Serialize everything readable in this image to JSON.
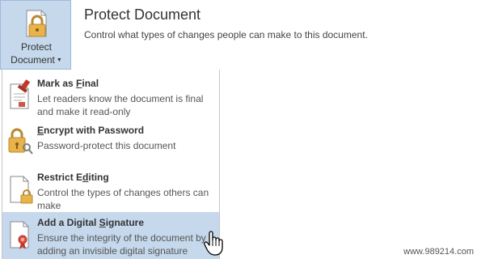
{
  "protect_button": {
    "label_line1": "Protect",
    "label_line2": "Document",
    "icon": "lock-document-icon"
  },
  "header": {
    "title": "Protect Document",
    "description": "Control what types of changes people can make to this document."
  },
  "menu": {
    "items": [
      {
        "title_pre": "Mark as ",
        "title_mnemonic": "F",
        "title_post": "inal",
        "description": "Let readers know the document is final and make it read-only",
        "icon": "mark-as-final-icon"
      },
      {
        "title_pre": "",
        "title_mnemonic": "E",
        "title_post": "ncrypt with Password",
        "description": "Password-protect this document",
        "icon": "lock-key-icon"
      },
      {
        "title_pre": "Restrict E",
        "title_mnemonic": "d",
        "title_post": "iting",
        "description": "Control the types of changes others can make",
        "icon": "restrict-editing-icon"
      },
      {
        "title_pre": "Add a Digital ",
        "title_mnemonic": "S",
        "title_post": "ignature",
        "description": "Ensure the integrity of the document by adding an invisible digital signature",
        "icon": "digital-signature-icon",
        "highlighted": true
      }
    ]
  },
  "colors": {
    "highlight": "#c5d8ec",
    "lock_gold": "#e8b34a",
    "stamp_red": "#c0392b"
  },
  "watermark": "www.989214.com"
}
